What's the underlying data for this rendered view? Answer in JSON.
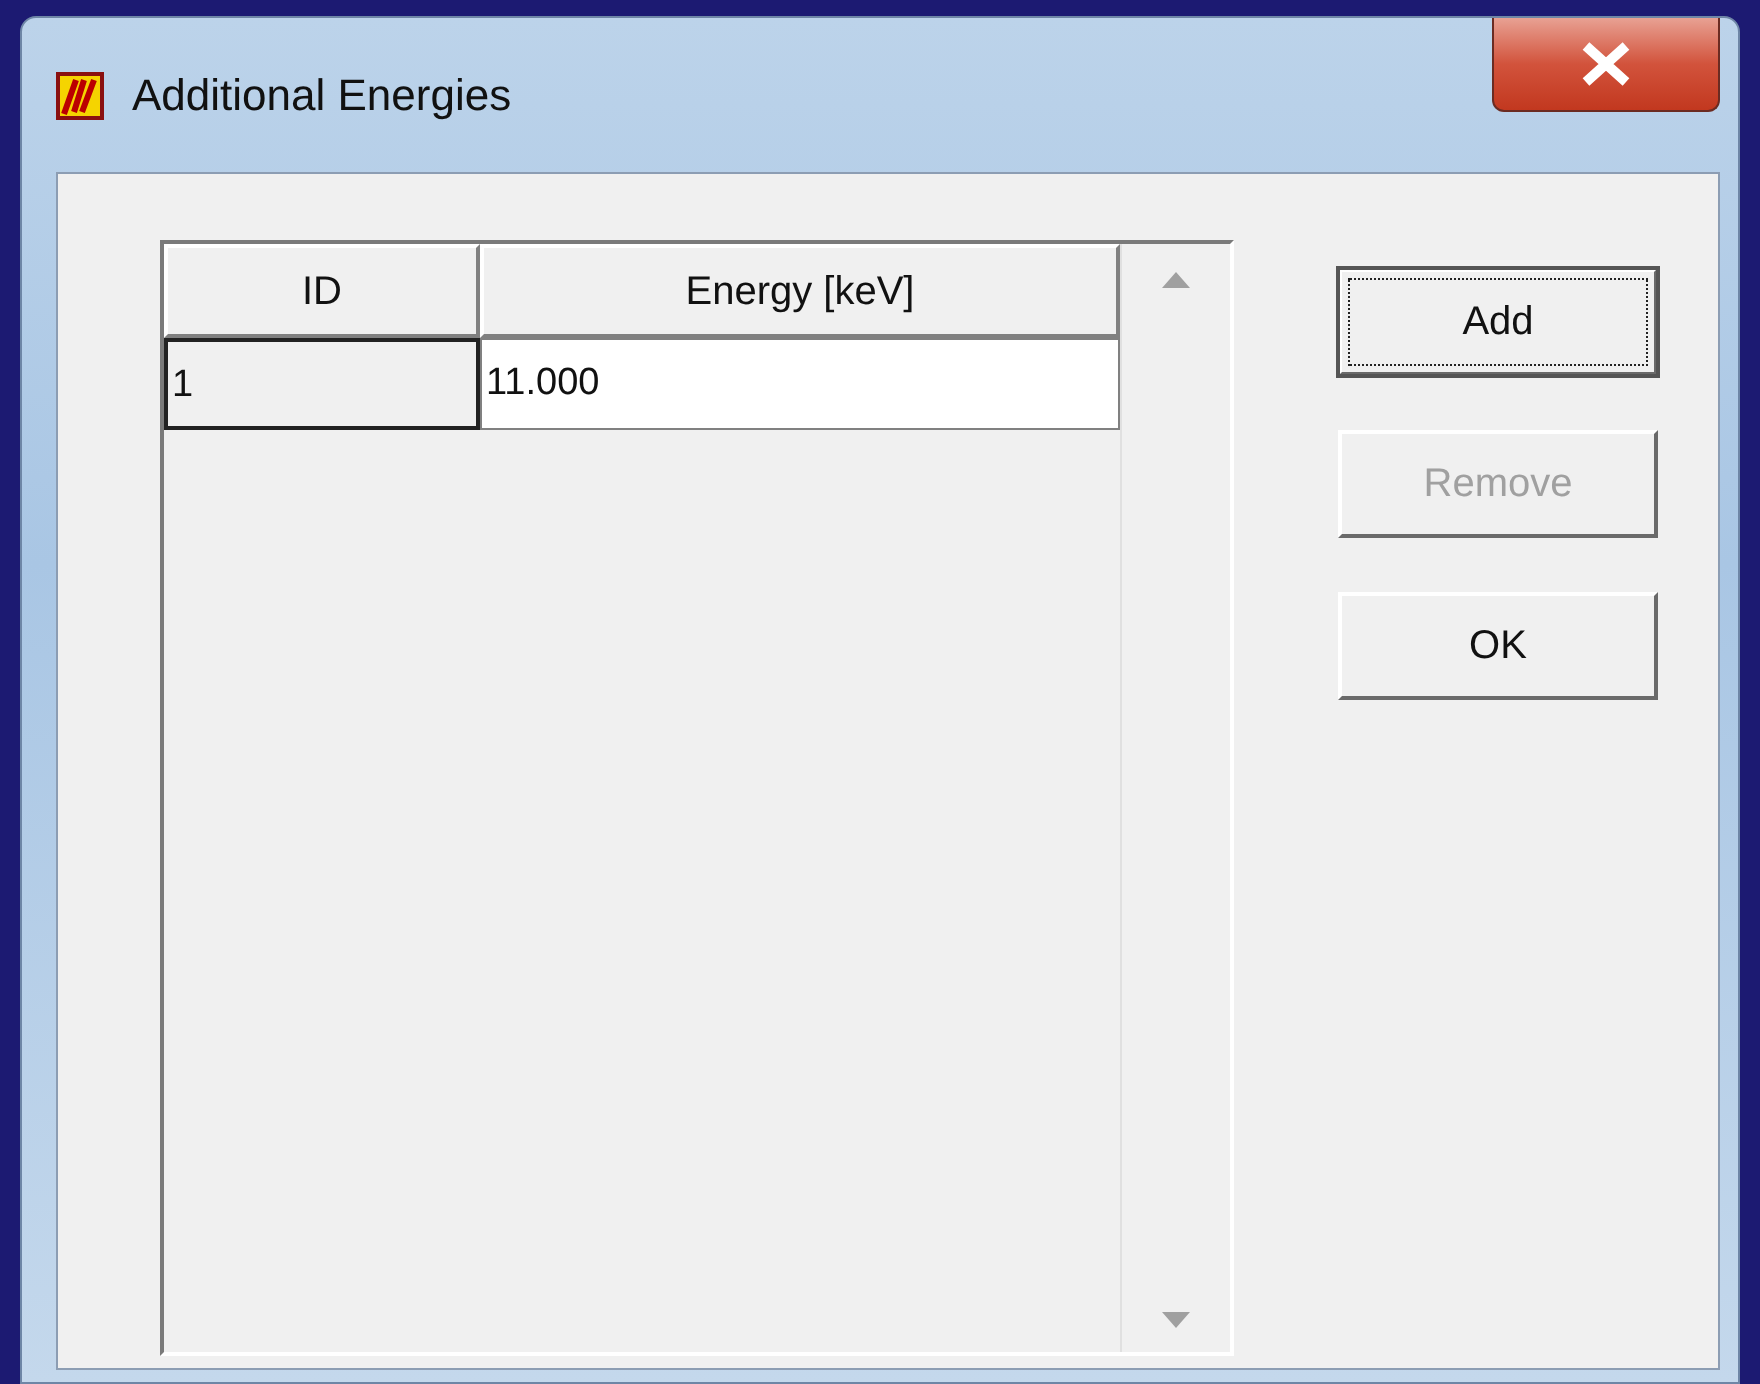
{
  "window": {
    "title": "Additional Energies"
  },
  "table": {
    "columns": [
      "ID",
      "Energy [keV]"
    ],
    "rows": [
      [
        "1",
        "11.000"
      ]
    ]
  },
  "buttons": [
    {
      "label": "Add",
      "focused": true,
      "disabled": false
    },
    {
      "label": "Remove",
      "focused": false,
      "disabled": true
    },
    {
      "label": "OK",
      "focused": false,
      "disabled": false
    }
  ]
}
